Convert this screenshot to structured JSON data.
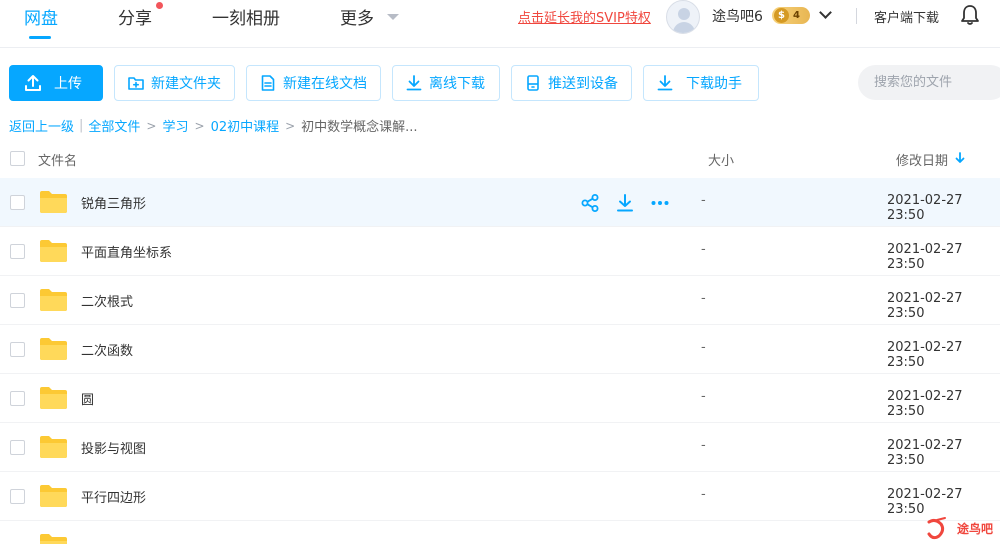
{
  "nav": {
    "items": [
      {
        "label": "网盘"
      },
      {
        "label": "分享"
      },
      {
        "label": "一刻相册"
      },
      {
        "label": "更多"
      }
    ],
    "svip_link": "点击延长我的SVIP特权",
    "username": "途鸟吧6",
    "vip_level": "4",
    "client_download": "客户端下载",
    "accent": "#06a7ff",
    "alert_color": "#f0473e"
  },
  "toolbar": {
    "upload": "上传",
    "new_folder": "新建文件夹",
    "new_online_doc": "新建在线文档",
    "offline_download": "离线下载",
    "push_device": "推送到设备",
    "download_helper": "下载助手",
    "search_placeholder": "搜索您的文件"
  },
  "breadcrumb": {
    "back": "返回上一级",
    "all_files": "全部文件",
    "path": [
      "学习",
      "02初中课程"
    ],
    "current": "初中数学概念课解..."
  },
  "table": {
    "col_name": "文件名",
    "col_size": "大小",
    "col_date": "修改日期",
    "rows": [
      {
        "name": "锐角三角形",
        "size": "-",
        "date": "2021-02-27 23:50"
      },
      {
        "name": "平面直角坐标系",
        "size": "-",
        "date": "2021-02-27 23:50"
      },
      {
        "name": "二次根式",
        "size": "-",
        "date": "2021-02-27 23:50"
      },
      {
        "name": "二次函数",
        "size": "-",
        "date": "2021-02-27 23:50"
      },
      {
        "name": "圆",
        "size": "-",
        "date": "2021-02-27 23:50"
      },
      {
        "name": "投影与视图",
        "size": "-",
        "date": "2021-02-27 23:50"
      },
      {
        "name": "平行四边形",
        "size": "-",
        "date": "2021-02-27 23:50"
      }
    ]
  },
  "watermark": "途鸟吧"
}
